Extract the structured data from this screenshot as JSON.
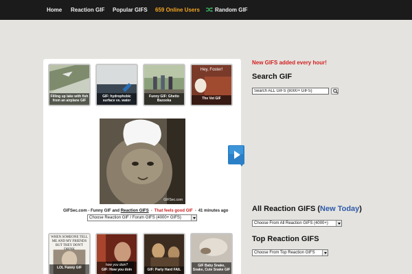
{
  "nav": {
    "home": "Home",
    "reaction": "Reaction GIF",
    "popular": "Popular GIFS",
    "online": "659 Online Users",
    "random": "Random GIF"
  },
  "icons": {
    "random": "shuffle-icon",
    "play": "play-icon",
    "search": "search-icon"
  },
  "colors": {
    "nav_bg": "#1b1b1b",
    "online": "#f5a623",
    "announce": "#d21f1f",
    "link": "#2f5aa8",
    "page_bg": "#e4e3df"
  },
  "top_thumbs": [
    {
      "caption": "Filling up lake with fish from an airplane GIF"
    },
    {
      "caption": "GIF: hydrophobic surface vs. water"
    },
    {
      "caption": "Funny GIF: Ghetto Bazooka"
    },
    {
      "caption": "The Vet GIF",
      "overlay": "Hey, Foster!"
    }
  ],
  "featured": {
    "watermark": "GIFSec.com",
    "site": "GIFSec.com - Funny GIF and",
    "category": "Reaction GIFS",
    "tagline": "That feels good GIF",
    "time": "41 minutes ago",
    "select": "Choose Reaction GIF / Forum GIFS (4000+ GIFS)"
  },
  "bottom_thumbs": [
    {
      "caption": "LOL Funny GIF",
      "overlay": "WHEN SOMEONE TELL ME AND MY FRIENDS BUT THEY DON'T DRINK"
    },
    {
      "caption": "GIF: How you doin",
      "overlay": "how you doin?"
    },
    {
      "caption": "GIF: Party Hard FAIL"
    },
    {
      "caption": "GIF Baby Snake, Snake, Cute Snake GIF"
    }
  ],
  "sidebar": {
    "announcement": "New GIFS added every hour!",
    "search_heading": "Search GIF",
    "search_value": "Search ALL GIFS (8000+ GIFS)",
    "all_heading": "All Reaction GIFS",
    "all_link": "New Today",
    "all_select": "Choose From All Reaction GIFS (4000+)",
    "top_heading": "Top Reaction GIFS",
    "top_select": "Choose From Top Reaction GIFS"
  }
}
